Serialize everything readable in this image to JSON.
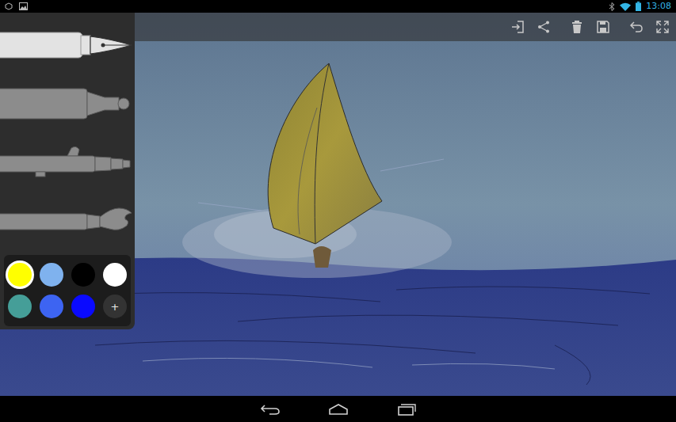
{
  "status_bar": {
    "time": "13:08"
  },
  "tools": [
    {
      "kind": "pen",
      "selected": true
    },
    {
      "kind": "marker",
      "selected": false
    },
    {
      "kind": "airbrush",
      "selected": false
    },
    {
      "kind": "brush",
      "selected": false
    }
  ],
  "palette": {
    "colors": [
      {
        "color": "#ffff00",
        "selected": true
      },
      {
        "color": "#7fb2ee",
        "selected": false
      },
      {
        "color": "#000000",
        "selected": false
      },
      {
        "color": "#ffffff",
        "selected": false
      },
      {
        "color": "#459e98",
        "selected": false
      },
      {
        "color": "#3d64f2",
        "selected": false
      },
      {
        "color": "#0a0aff",
        "selected": false
      }
    ],
    "add_button": "+"
  }
}
